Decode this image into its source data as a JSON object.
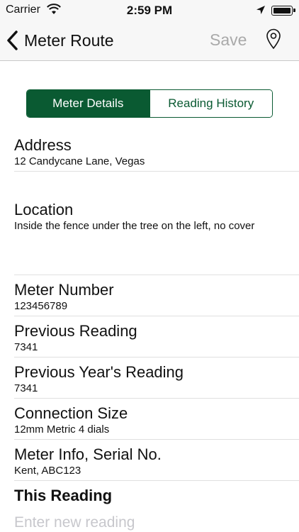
{
  "status_bar": {
    "carrier": "Carrier",
    "time": "2:59 PM"
  },
  "nav": {
    "back_title": "Meter Route",
    "save_label": "Save",
    "save_enabled": false,
    "icons": [
      "chevron-left-icon",
      "map-pin-icon"
    ]
  },
  "tabs": [
    {
      "label": "Meter Details",
      "selected": true
    },
    {
      "label": "Reading History",
      "selected": false
    }
  ],
  "fields": {
    "address": {
      "label": "Address",
      "value": "12 Candycane Lane, Vegas"
    },
    "location": {
      "label": "Location",
      "value": "Inside the fence under the tree on the left, no cover"
    },
    "meter_number": {
      "label": "Meter Number",
      "value": "123456789"
    },
    "previous_reading": {
      "label": "Previous Reading",
      "value": "7341"
    },
    "previous_year_reading": {
      "label": "Previous Year's Reading",
      "value": "7341"
    },
    "connection_size": {
      "label": "Connection Size",
      "value": "12mm Metric 4 dials"
    },
    "meter_info": {
      "label": "Meter Info, Serial No.",
      "value": "Kent, ABC123"
    }
  },
  "this_reading": {
    "label": "This Reading",
    "placeholder": "Enter new reading",
    "value": ""
  },
  "colors": {
    "accent": "#0a5a32",
    "disabled_text": "#a9a9a9",
    "bar_background": "#f7f7f7"
  }
}
